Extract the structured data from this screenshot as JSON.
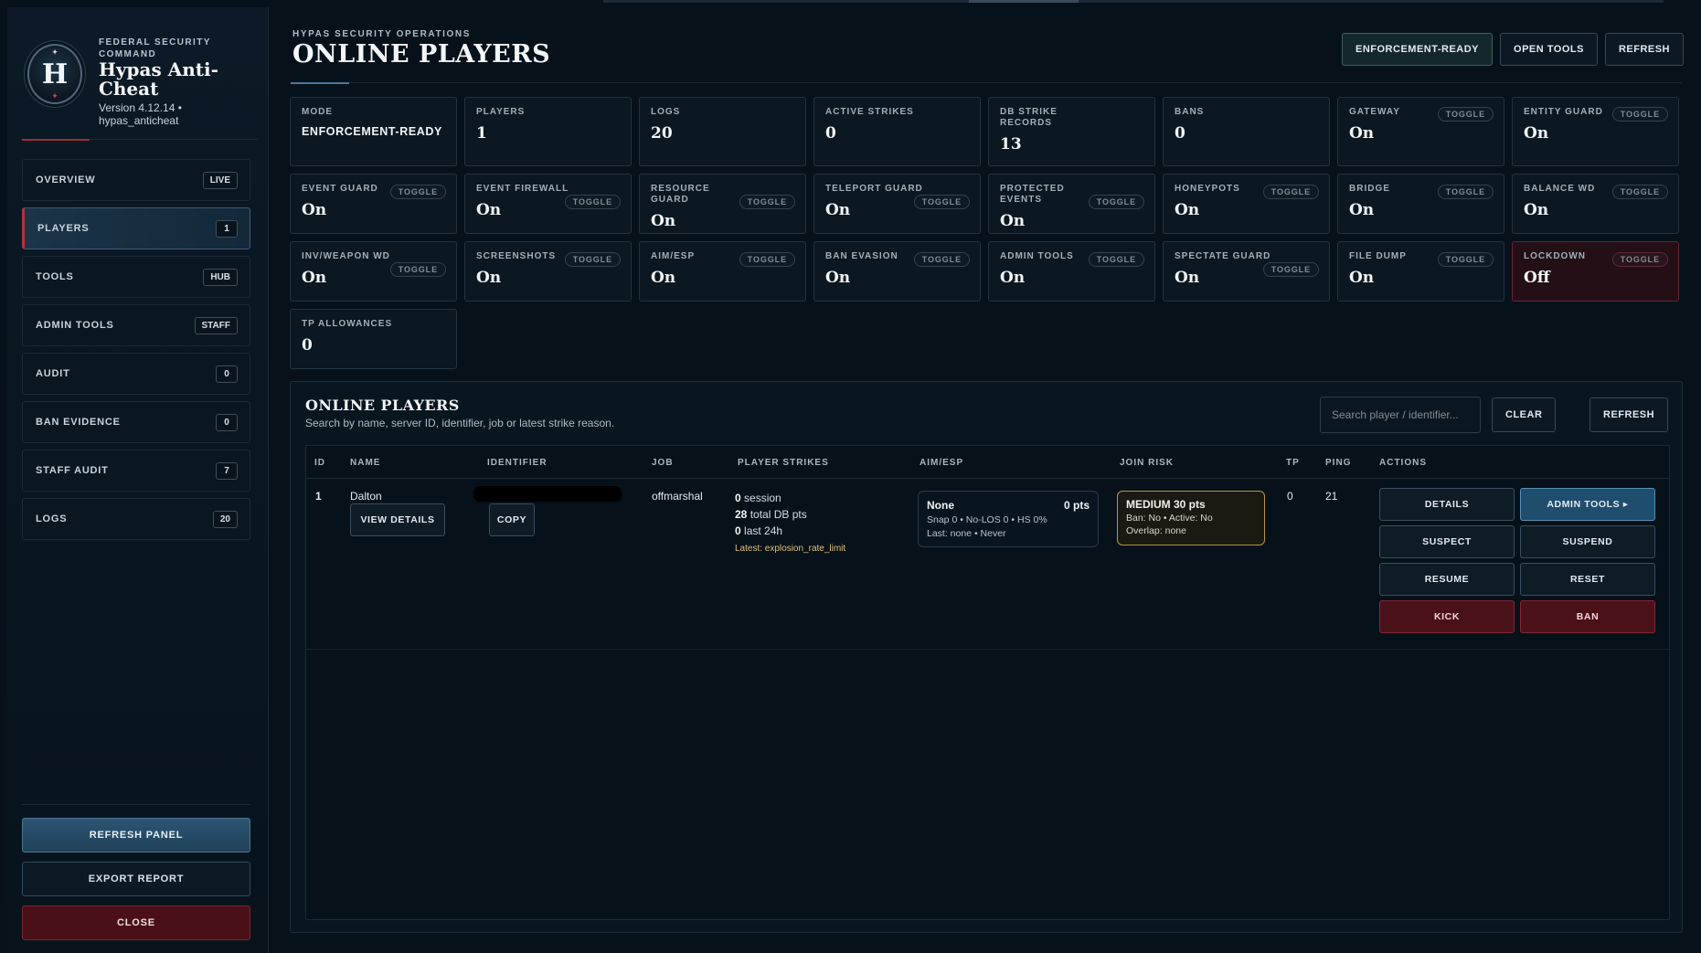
{
  "brand": {
    "kicker": "FEDERAL SECURITY COMMAND",
    "title": "Hypas Anti-Cheat",
    "version": "Version 4.12.14 • hypas_anticheat",
    "logo_letter": "H"
  },
  "sidebar": {
    "items": [
      {
        "label": "OVERVIEW",
        "badge": "LIVE"
      },
      {
        "label": "PLAYERS",
        "badge": "1"
      },
      {
        "label": "TOOLS",
        "badge": "HUB"
      },
      {
        "label": "ADMIN TOOLS",
        "badge": "STAFF"
      },
      {
        "label": "AUDIT",
        "badge": "0"
      },
      {
        "label": "BAN EVIDENCE",
        "badge": "0"
      },
      {
        "label": "STAFF AUDIT",
        "badge": "7"
      },
      {
        "label": "LOGS",
        "badge": "20"
      }
    ],
    "active_index": 1,
    "refresh_label": "REFRESH PANEL",
    "export_label": "EXPORT REPORT",
    "close_label": "CLOSE"
  },
  "header": {
    "kicker": "HYPAS SECURITY OPERATIONS",
    "title": "ONLINE PLAYERS",
    "buttons": [
      "ENFORCEMENT-READY",
      "OPEN TOOLS",
      "REFRESH"
    ]
  },
  "toggle_label": "TOGGLE",
  "stats": [
    {
      "label": "MODE",
      "value": "ENFORCEMENT-READY",
      "toggle": false
    },
    {
      "label": "PLAYERS",
      "value": "1",
      "toggle": false
    },
    {
      "label": "LOGS",
      "value": "20",
      "toggle": false
    },
    {
      "label": "ACTIVE STRIKES",
      "value": "0",
      "toggle": false
    },
    {
      "label": "DB STRIKE RECORDS",
      "value": "13",
      "toggle": false
    },
    {
      "label": "BANS",
      "value": "0",
      "toggle": false
    },
    {
      "label": "GATEWAY",
      "value": "On",
      "toggle": true
    },
    {
      "label": "ENTITY GUARD",
      "value": "On",
      "toggle": true
    },
    {
      "label": "EVENT GUARD",
      "value": "On",
      "toggle": true
    },
    {
      "label": "EVENT FIREWALL",
      "value": "On",
      "toggle": true
    },
    {
      "label": "RESOURCE GUARD",
      "value": "On",
      "toggle": true
    },
    {
      "label": "TELEPORT GUARD",
      "value": "On",
      "toggle": true
    },
    {
      "label": "PROTECTED EVENTS",
      "value": "On",
      "toggle": true
    },
    {
      "label": "HONEYPOTS",
      "value": "On",
      "toggle": true
    },
    {
      "label": "BRIDGE",
      "value": "On",
      "toggle": true
    },
    {
      "label": "BALANCE WD",
      "value": "On",
      "toggle": true
    },
    {
      "label": "INV/WEAPON WD",
      "value": "On",
      "toggle": true
    },
    {
      "label": "SCREENSHOTS",
      "value": "On",
      "toggle": true
    },
    {
      "label": "AIM/ESP",
      "value": "On",
      "toggle": true
    },
    {
      "label": "BAN EVASION",
      "value": "On",
      "toggle": true
    },
    {
      "label": "ADMIN TOOLS",
      "value": "On",
      "toggle": true
    },
    {
      "label": "SPECTATE GUARD",
      "value": "On",
      "toggle": true
    },
    {
      "label": "FILE DUMP",
      "value": "On",
      "toggle": true
    },
    {
      "label": "LOCKDOWN",
      "value": "Off",
      "toggle": true,
      "danger": true
    },
    {
      "label": "TP ALLOWANCES",
      "value": "0",
      "toggle": false
    }
  ],
  "players_panel": {
    "title": "ONLINE PLAYERS",
    "subtitle": "Search by name, server ID, identifier, job or latest strike reason.",
    "search_placeholder": "Search player / identifier...",
    "clear_label": "CLEAR",
    "refresh_label": "REFRESH",
    "columns": [
      "ID",
      "NAME",
      "IDENTIFIER",
      "JOB",
      "PLAYER STRIKES",
      "AIM/ESP",
      "JOIN RISK",
      "TP",
      "PING",
      "ACTIONS"
    ],
    "rows": [
      {
        "id": "1",
        "name": "Dalton",
        "view_details_label": "VIEW DETAILS",
        "copy_label": "COPY",
        "job": "offmarshal",
        "strikes": {
          "session": "0",
          "session_label": "session",
          "db": "28",
          "db_label": "total DB pts",
          "last24": "0",
          "last24_label": "last 24h",
          "latest": "Latest: explosion_rate_limit"
        },
        "aim": {
          "status": "None",
          "pts": "0 pts",
          "line1": "Snap 0 • No-LOS 0 • HS 0%",
          "line2": "Last: none • Never"
        },
        "risk": {
          "title": "MEDIUM 30 pts",
          "line1": "Ban: No • Active: No",
          "line2": "Overlap: none"
        },
        "tp": "0",
        "ping": "21",
        "actions": [
          "DETAILS",
          "ADMIN TOOLS ▸",
          "SUSPECT",
          "SUSPEND",
          "RESUME",
          "RESET",
          "KICK",
          "BAN"
        ]
      }
    ]
  },
  "colors": {
    "accent_red": "#b3323e",
    "primary_blue": "#1f4d6e",
    "risk_gold": "#b8943f"
  }
}
